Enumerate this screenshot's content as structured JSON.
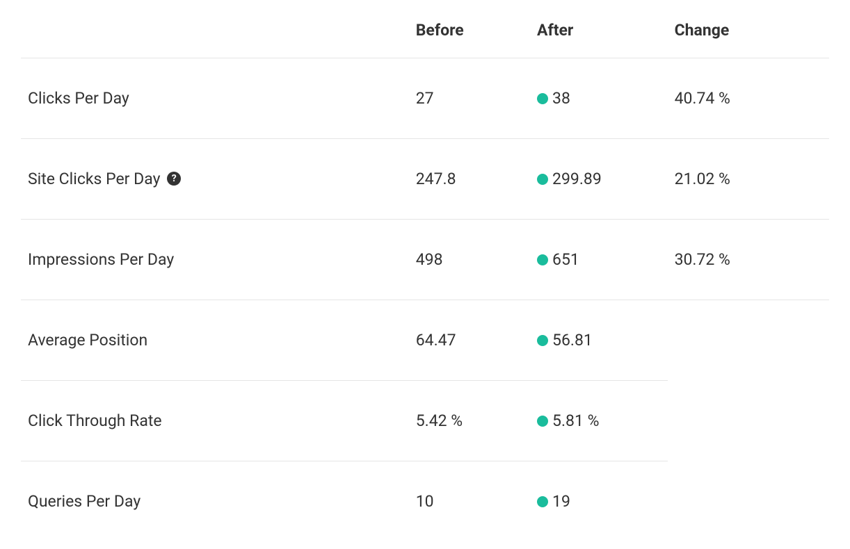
{
  "colors": {
    "positive_dot": "#1abc9c"
  },
  "table": {
    "headers": {
      "metric": "",
      "before": "Before",
      "after": "After",
      "change": "Change"
    },
    "rows": [
      {
        "label": "Clicks Per Day",
        "has_help": false,
        "before": "27",
        "after": "38",
        "change": "40.74 %",
        "full_border": true
      },
      {
        "label": "Site Clicks Per Day",
        "has_help": true,
        "before": "247.8",
        "after": "299.89",
        "change": "21.02 %",
        "full_border": true
      },
      {
        "label": "Impressions Per Day",
        "has_help": false,
        "before": "498",
        "after": "651",
        "change": "30.72 %",
        "full_border": true
      },
      {
        "label": "Average Position",
        "has_help": false,
        "before": "64.47",
        "after": "56.81",
        "change": "",
        "full_border": false
      },
      {
        "label": "Click Through Rate",
        "has_help": false,
        "before": "5.42 %",
        "after": "5.81 %",
        "change": "",
        "full_border": false
      },
      {
        "label": "Queries Per Day",
        "has_help": false,
        "before": "10",
        "after": "19",
        "change": "",
        "full_border": true
      }
    ]
  }
}
